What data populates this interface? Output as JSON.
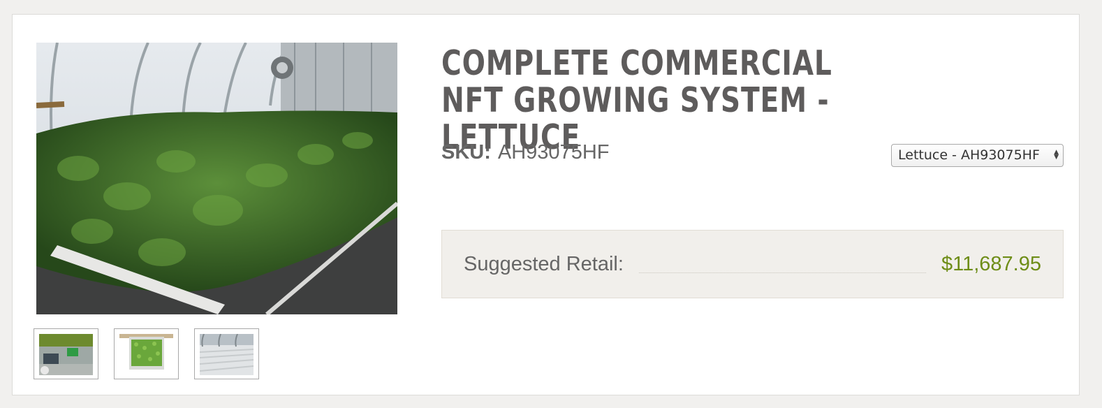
{
  "product": {
    "title": "Complete Commercial NFT Growing System - Lettuce",
    "sku_label": "SKU:",
    "sku_value": "AH93075HF"
  },
  "variant_select": {
    "selected": "Lettuce - AH93075HF"
  },
  "pricing": {
    "retail_label": "Suggested Retail:",
    "retail_price": "$11,687.95"
  },
  "images": {
    "main": "greenhouse-nft-basil-photo",
    "thumbnails": [
      "nft-pump-reservoir-thumbnail",
      "nft-grow-tray-thumbnail",
      "greenhouse-channels-thumbnail"
    ]
  },
  "colors": {
    "title": "#5e5c5c",
    "price": "#6e8d17",
    "retail_box_bg": "#f1efeb"
  }
}
